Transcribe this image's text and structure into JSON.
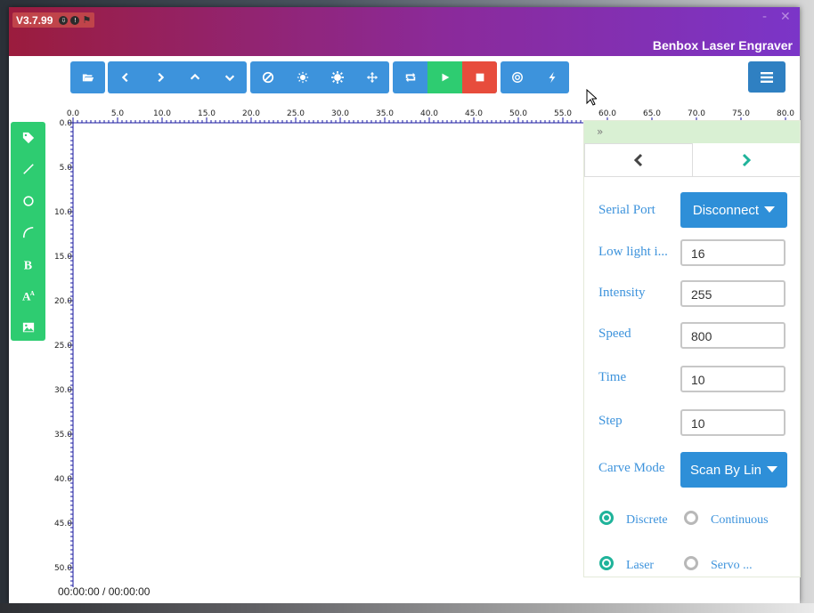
{
  "app": {
    "version": "V3.7.99",
    "title": "Benbox Laser Engraver",
    "minimize": "-",
    "close": "✕"
  },
  "toolbar": {
    "group1": [
      "folder-open-icon"
    ],
    "group2": [
      "chevron-left-icon",
      "chevron-right-icon",
      "chevron-up-icon",
      "chevron-down-icon"
    ],
    "group3": [
      "ban-icon",
      "sun-small-icon",
      "sun-large-icon",
      "move-icon"
    ],
    "group4": [
      "repeat-icon",
      "play-icon",
      "stop-icon"
    ],
    "group5": [
      "target-icon",
      "bolt-icon"
    ],
    "menu": "menu-icon",
    "colors": {
      "blue": "#3d93dc",
      "green": "#2ecc71",
      "red": "#e74c3c"
    }
  },
  "left_tools": [
    "tag-icon",
    "line-icon",
    "circle-icon",
    "arc-icon",
    "bold-icon",
    "text-size-icon",
    "image-icon"
  ],
  "ruler": {
    "x_labels": [
      "0.0",
      "5.0",
      "10.0",
      "15.0",
      "20.0",
      "25.0",
      "30.0",
      "35.0",
      "40.0",
      "45.0",
      "50.0",
      "55.0",
      "60.0",
      "65.0",
      "70.0",
      "75.0",
      "80.0"
    ],
    "y_labels": [
      "0.0",
      "5.0",
      "10.0",
      "15.0",
      "20.0",
      "25.0",
      "30.0",
      "35.0",
      "40.0",
      "45.0",
      "50.0"
    ]
  },
  "status": {
    "time": "00:00:00 / 00:00:00"
  },
  "panel": {
    "collapse": "»",
    "serial_port": {
      "label": "Serial Port",
      "button": "Disconnect"
    },
    "low_light": {
      "label": "Low light i...",
      "value": "16"
    },
    "intensity": {
      "label": "Intensity",
      "value": "255"
    },
    "speed": {
      "label": "Speed",
      "value": "800"
    },
    "time": {
      "label": "Time",
      "value": "10"
    },
    "step": {
      "label": "Step",
      "value": "10"
    },
    "carve_mode": {
      "label": "Carve Mode",
      "value": "Scan By Lin"
    },
    "radio_discrete": "Discrete",
    "radio_continuous": "Continuous",
    "radio_laser": "Laser",
    "radio_servo": "Servo ..."
  }
}
